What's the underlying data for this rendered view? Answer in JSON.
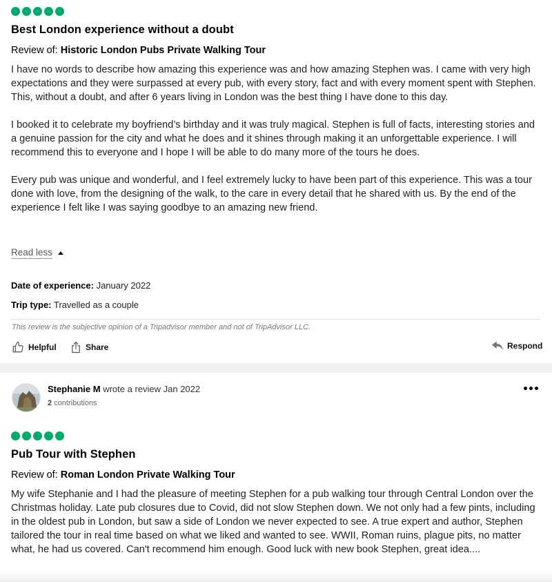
{
  "reviews": [
    {
      "rating_bubbles": 5,
      "title": "Best London experience without a doubt",
      "review_of_label": "Review of:",
      "tour_name": "Historic London Pubs Private Walking Tour",
      "paragraphs": [
        "I have no words to describe how amazing this experience was and how amazing Stephen was. I came with very high expectations and they were surpassed at every pub, with every story, fact and with every moment spent with Stephen. This, without a doubt, and after 6 years living in London was the best thing I have done to this day.",
        "I booked it to celebrate my boyfriend’s birthday and it was truly magical. Stephen is full of facts, interesting stories and a genuine passion for the city and what he does and it shines through making it an unforgettable experience. I will recommend this to everyone and I hope I will be able to do many more of the tours he does.",
        "Every pub was unique and wonderful, and I feel extremely lucky to have been part of this experience. This was a tour done with love, from the designing of the walk, to the care in every detail that he shared with us. By the end of the experience I felt like I was saying goodbye to an amazing new friend."
      ],
      "read_less_label": "Read less",
      "date_label": "Date of experience:",
      "date_value": "January 2022",
      "trip_type_label": "Trip type:",
      "trip_type_value": "Travelled as a couple",
      "disclaimer": "This review is the subjective opinion of a Tripadvisor member and not of TripAdvisor LLC.",
      "helpful_label": "Helpful",
      "share_label": "Share",
      "respond_label": "Respond"
    },
    {
      "author": "Stephanie M",
      "wrote_text": "wrote a review Jan 2022",
      "contributions_count": "2",
      "contributions_label": "contributions",
      "rating_bubbles": 5,
      "title": "Pub Tour with Stephen",
      "review_of_label": "Review of:",
      "tour_name": "Roman London Private Walking Tour",
      "body": "My wife Stephanie and I had the pleasure of meeting Stephen for a pub walking tour through Central London over the Christmas holiday. Late pub closures due to Covid, did not slow Stephen down. We not only had a few pints, including in the oldest pub in London, but saw a side of London we never expected to see. A true expert and author, Stephen tailored the tour in real time based on what we liked and wanted to see. WWII, Roman ruins, plague pits, no matter what, he had us covered. Can't recommend him enough. Good luck with new book Stephen, great idea...."
    }
  ],
  "icons": {
    "rating_bubble": "filled-circle",
    "helpful": "thumbs-up-icon",
    "share": "share-icon",
    "respond": "reply-arrow-icon",
    "more": "more-options-icon",
    "read_less": "caret-up-icon"
  },
  "colors": {
    "rating_green": "#00aa6c",
    "separator": "#f0f0f0"
  }
}
